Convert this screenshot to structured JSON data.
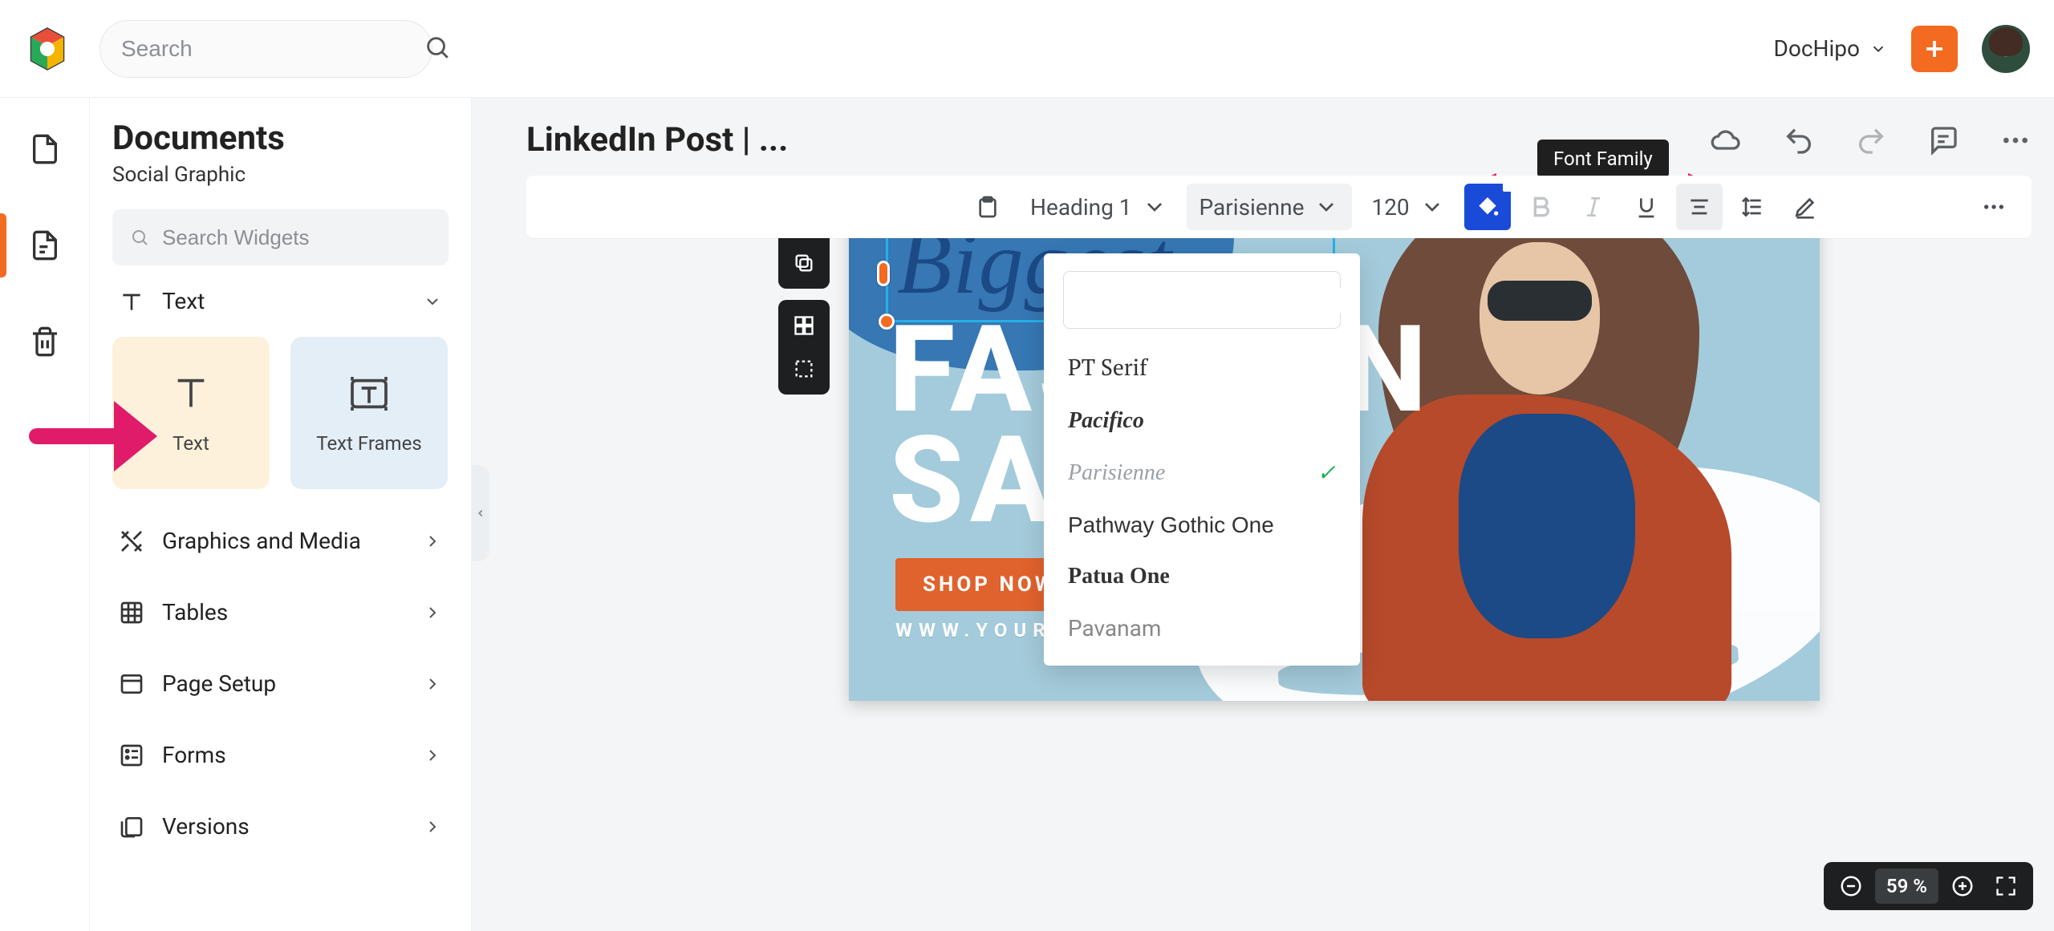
{
  "topbar": {
    "search_placeholder": "Search",
    "workspace_label": "DocHipo"
  },
  "panel": {
    "title": "Documents",
    "subtitle": "Social Graphic",
    "widget_search_placeholder": "Search Widgets",
    "sections": {
      "text": "Text",
      "graphics": "Graphics and Media",
      "tables": "Tables",
      "page_setup": "Page Setup",
      "forms": "Forms",
      "versions": "Versions"
    },
    "widgets": {
      "text_card": "Text",
      "text_frames_card": "Text Frames"
    }
  },
  "document": {
    "title": "LinkedIn Post | ..."
  },
  "toolbar": {
    "heading_label": "Heading 1",
    "font_family": "Parisienne",
    "font_size": "120",
    "tooltip": "Font Family"
  },
  "font_picker": {
    "options": {
      "pt_serif": "PT Serif",
      "pacifico": "Pacifico",
      "parisienne": "Parisienne",
      "pathway": "Pathway Gothic One",
      "patua": "Patua One",
      "pavanam": "Pavanam"
    },
    "selected": "Parisienne"
  },
  "canvas": {
    "headline_script": "Biggest",
    "headline_block": "FASHION\nSALE",
    "cta": "SHOP NOW",
    "url": "WWW.YOURWEBSITE.COM"
  },
  "zoom": {
    "value": "59 %"
  }
}
